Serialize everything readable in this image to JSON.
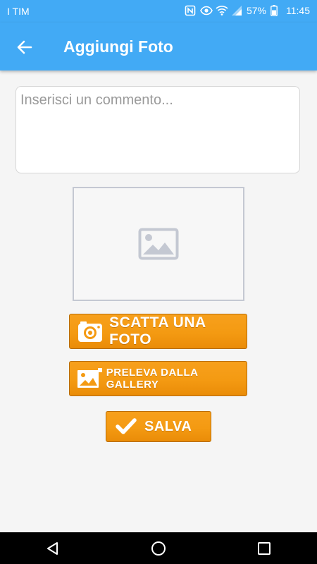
{
  "status_bar": {
    "carrier": "I TIM",
    "battery": "57%",
    "time": "11:45"
  },
  "app_bar": {
    "title": "Aggiungi Foto",
    "back_icon": "arrow-left-icon"
  },
  "comment": {
    "placeholder": "Inserisci un commento...",
    "value": ""
  },
  "photo": {
    "placeholder_icon": "image-placeholder-icon"
  },
  "buttons": {
    "camera": {
      "label": "SCATTA UNA FOTO",
      "icon": "camera-icon"
    },
    "gallery": {
      "label": "PRELEVA DALLA GALLERY",
      "icon": "gallery-icon"
    },
    "save": {
      "label": "SALVA",
      "icon": "checkmark-icon"
    }
  },
  "colors": {
    "app_bar": "#42aaf5",
    "button_orange": "#f49a12",
    "nav_bar": "#000000"
  },
  "nav_bar": {
    "back": "triangle-back-icon",
    "home": "circle-home-icon",
    "recents": "square-recents-icon"
  }
}
